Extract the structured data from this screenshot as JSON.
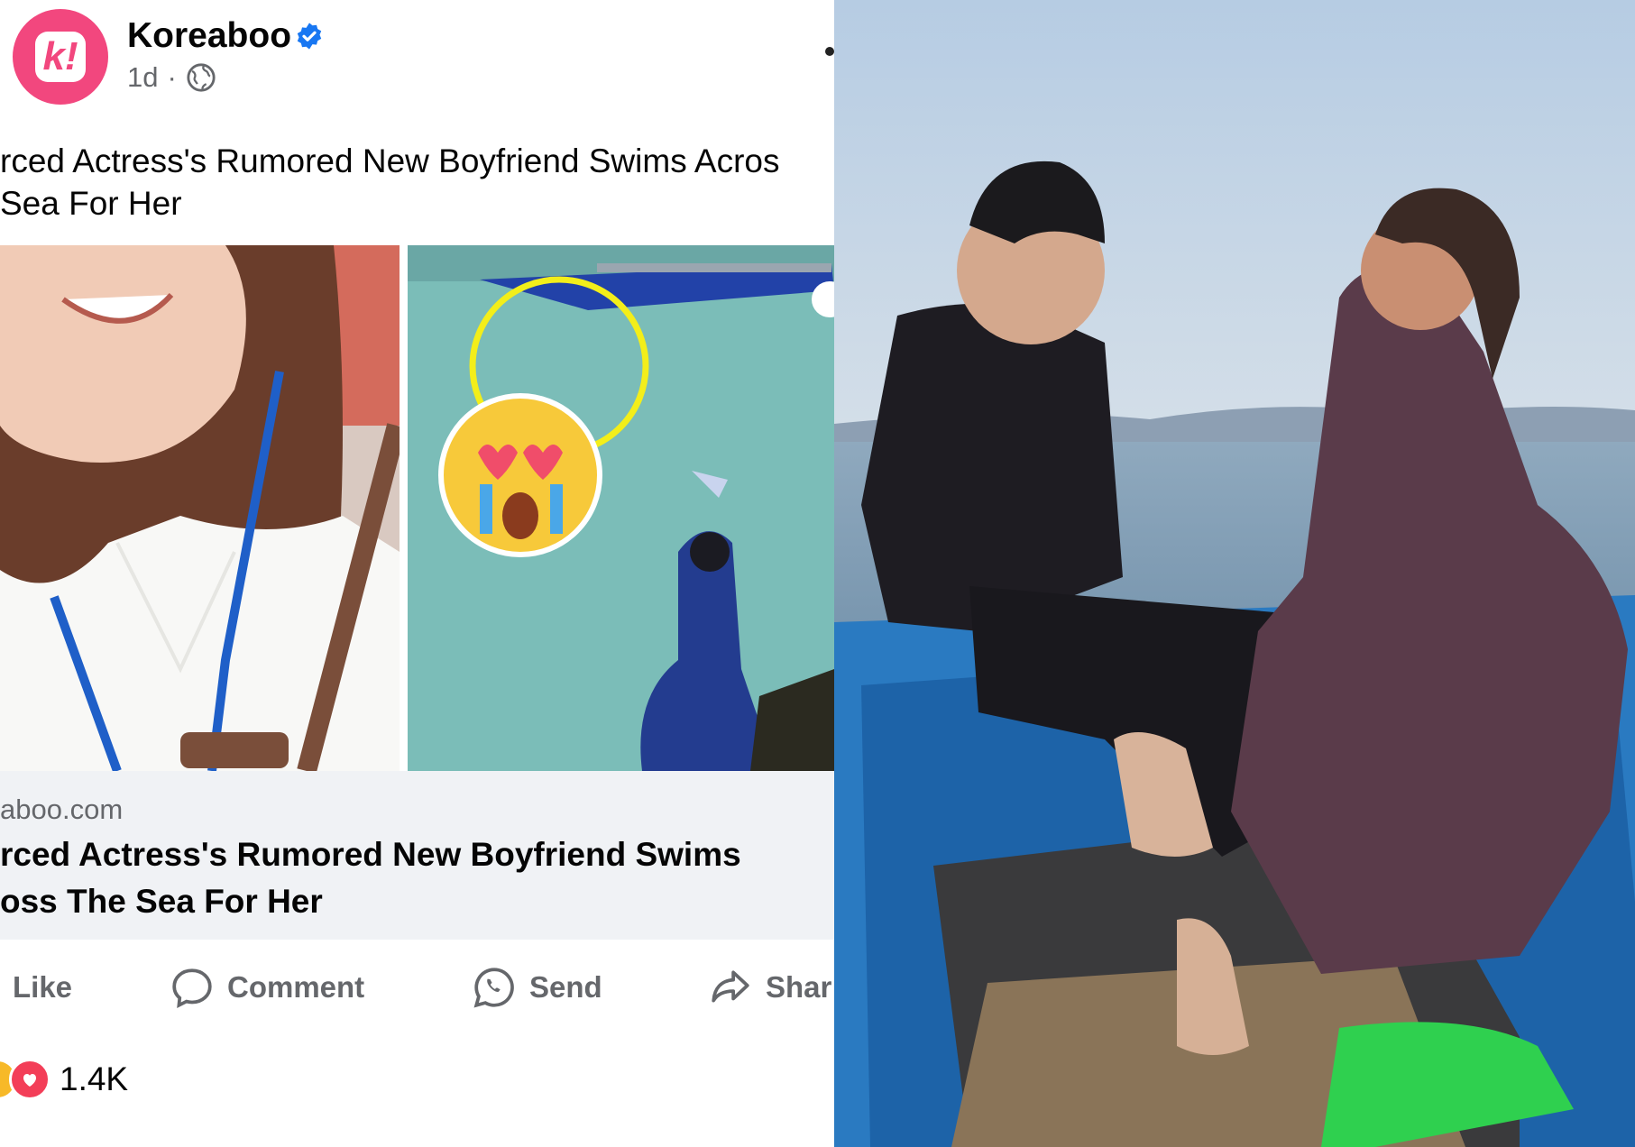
{
  "post": {
    "page_name": "Koreaboo",
    "avatar_letter": "k!",
    "time": "1d",
    "separator": "·",
    "text_line1": "rced Actress's Rumored New Boyfriend Swims Acros",
    "text_line2": "Sea For Her",
    "link": {
      "domain": "aboo.com",
      "title_line1": "rced Actress's Rumored New Boyfriend Swims",
      "title_line2": "oss The Sea For Her"
    },
    "actions": {
      "like": "Like",
      "comment": "Comment",
      "send": "Send",
      "share": "Shar"
    },
    "reaction_count": "1.4K"
  },
  "colors": {
    "brand": "#f2477e",
    "verified": "#1877f2",
    "meta_text": "#65676b",
    "link_bg": "#f0f2f5",
    "love": "#f33e58"
  },
  "icons": [
    "verified-badge-icon",
    "globe-icon",
    "comment-icon",
    "whatsapp-icon",
    "share-icon",
    "love-reaction-icon"
  ]
}
